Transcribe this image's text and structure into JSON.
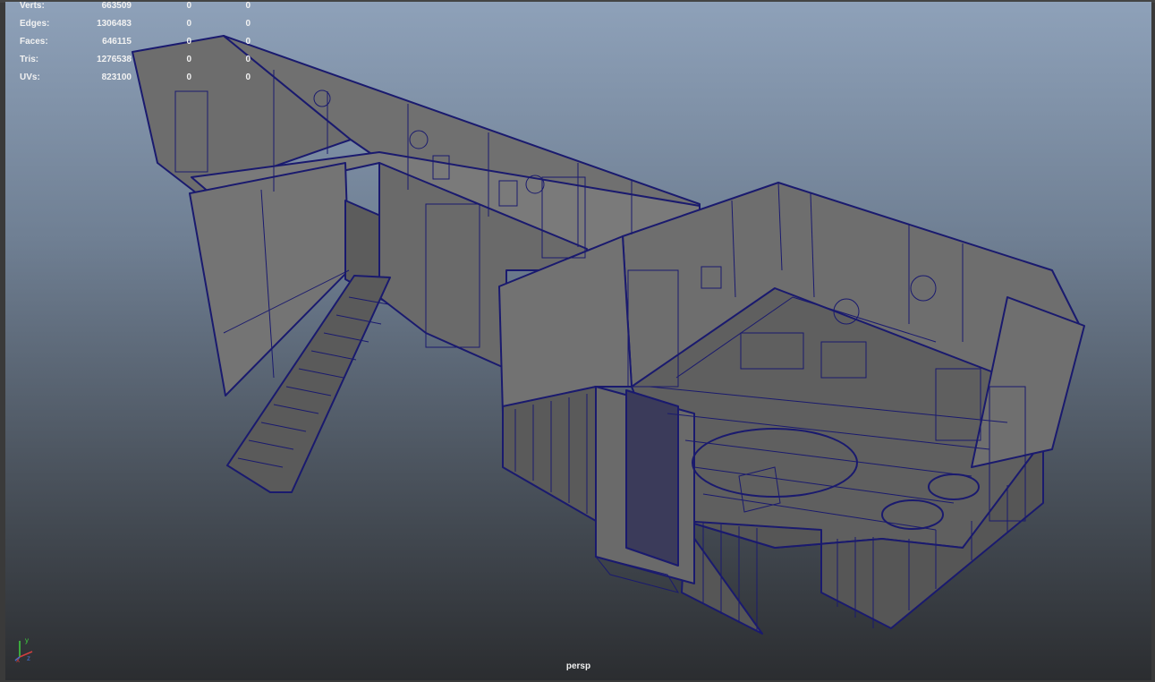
{
  "hud": {
    "rows": [
      {
        "label": "Verts:",
        "value": "663509",
        "sel": "0",
        "tri": "0"
      },
      {
        "label": "Edges:",
        "value": "1306483",
        "sel": "0",
        "tri": "0"
      },
      {
        "label": "Faces:",
        "value": "646115",
        "sel": "0",
        "tri": "0"
      },
      {
        "label": "Tris:",
        "value": "1276538",
        "sel": "0",
        "tri": "0"
      },
      {
        "label": "UVs:",
        "value": "823100",
        "sel": "0",
        "tri": "0"
      }
    ]
  },
  "camera": {
    "name": "persp"
  },
  "axis": {
    "x": "x",
    "y": "y",
    "z": "z"
  },
  "colors": {
    "wire": "#1a1a6e",
    "wall": "#6b6b6b",
    "floor": "#5e5e5e",
    "bg_top": "#8ea1b9",
    "bg_bottom": "#2b2d30"
  }
}
